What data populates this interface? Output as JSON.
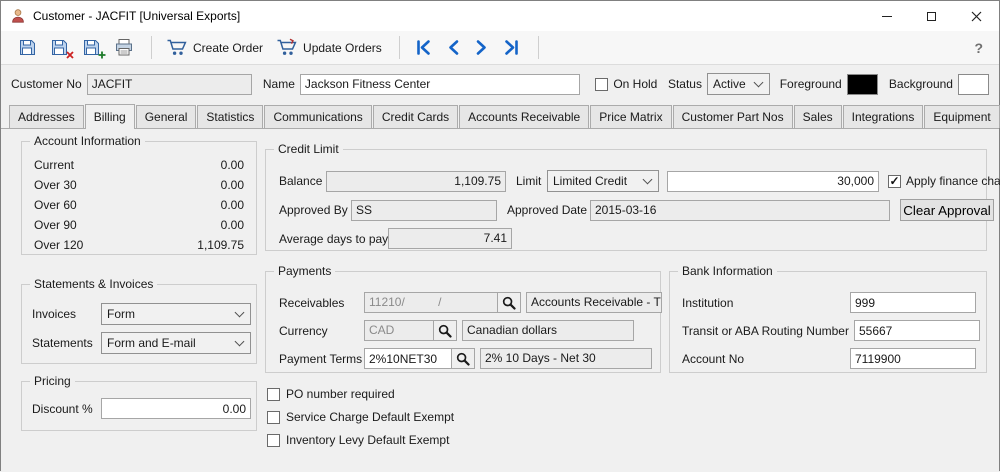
{
  "window": {
    "title": "Customer - JACFIT [Universal Exports]",
    "help_label": "?"
  },
  "toolbar": {
    "create_order_label": "Create Order",
    "update_orders_label": "Update Orders"
  },
  "header": {
    "customer_no_label": "Customer No",
    "customer_no": "JACFIT",
    "name_label": "Name",
    "name": "Jackson Fitness Center",
    "on_hold_label": "On Hold",
    "status_label": "Status",
    "status_value": "Active",
    "foreground_label": "Foreground",
    "foreground_color": "#000000",
    "background_label": "Background",
    "background_color": "#ffffff"
  },
  "tabs": [
    "Addresses",
    "Billing",
    "General",
    "Statistics",
    "Communications",
    "Credit Cards",
    "Accounts Receivable",
    "Price Matrix",
    "Customer Part Nos",
    "Sales",
    "Integrations",
    "Equipment"
  ],
  "billing": {
    "account_information": {
      "title": "Account Information",
      "rows": [
        {
          "label": "Current",
          "value": "0.00"
        },
        {
          "label": "Over 30",
          "value": "0.00"
        },
        {
          "label": "Over 60",
          "value": "0.00"
        },
        {
          "label": "Over 90",
          "value": "0.00"
        },
        {
          "label": "Over 120",
          "value": "1,109.75"
        }
      ]
    },
    "credit_limit": {
      "title": "Credit Limit",
      "balance_label": "Balance",
      "balance": "1,109.75",
      "limit_label": "Limit",
      "limit_value": "Limited Credit",
      "limit_amount": "30,000",
      "apply_finance_charges_label": "Apply finance charges",
      "apply_finance_charges_glyph": "✓",
      "approved_by_label": "Approved By",
      "approved_by": "SS",
      "approved_date_label": "Approved Date",
      "approved_date": "2015-03-16",
      "clear_approval_label": "Clear Approval",
      "average_days_label": "Average days to pay",
      "average_days": "7.41"
    },
    "statements_invoices": {
      "title": "Statements & Invoices",
      "invoices_label": "Invoices",
      "invoices_value": "Form",
      "statements_label": "Statements",
      "statements_value": "Form and E-mail"
    },
    "payments": {
      "title": "Payments",
      "receivables_label": "Receivables",
      "receivables_code": "11210/          /",
      "receivables_desc": "Accounts Receivable - Trad",
      "currency_label": "Currency",
      "currency_code": "CAD",
      "currency_desc": "Canadian dollars",
      "payment_terms_label": "Payment Terms",
      "payment_terms_code": "2%10NET30",
      "payment_terms_desc": "2% 10 Days - Net 30"
    },
    "bank_information": {
      "title": "Bank Information",
      "institution_label": "Institution",
      "institution": "999",
      "transit_label": "Transit or ABA Routing Number",
      "transit": "55667",
      "account_no_label": "Account No",
      "account_no": "7119900"
    },
    "pricing": {
      "title": "Pricing",
      "discount_label": "Discount %",
      "discount": "0.00"
    },
    "options": [
      {
        "label": "PO number required"
      },
      {
        "label": "Service Charge Default Exempt"
      },
      {
        "label": "Inventory Levy Default Exempt"
      }
    ]
  }
}
